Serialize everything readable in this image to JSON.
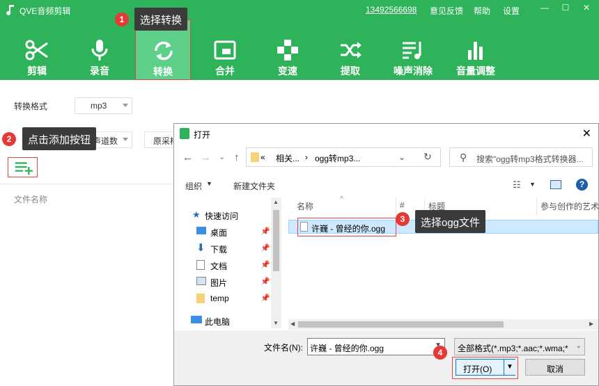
{
  "app": {
    "title": "QVE音频剪辑",
    "phone": "13492566698",
    "feedback": "意见反馈",
    "help": "帮助",
    "settings": "设置",
    "min_glyph": "—",
    "max_glyph": "☐",
    "close_glyph": "✕"
  },
  "toolbar": {
    "items": [
      {
        "label": "剪辑",
        "icon": "scissors-icon"
      },
      {
        "label": "录音",
        "icon": "microphone-icon"
      },
      {
        "label": "转换",
        "icon": "convert-icon"
      },
      {
        "label": "合并",
        "icon": "merge-icon"
      },
      {
        "label": "变速",
        "icon": "speed-icon"
      },
      {
        "label": "提取",
        "icon": "extract-icon"
      },
      {
        "label": "噪声消除",
        "icon": "noise-reduction-icon"
      },
      {
        "label": "音量调整",
        "icon": "volume-icon"
      }
    ],
    "active_index": 2
  },
  "convert": {
    "format_label": "转换格式",
    "format_value": "mp3",
    "channel_value": "声道数",
    "sample_value": "原采样",
    "file_col_header": "文件名称"
  },
  "tips": [
    {
      "num": "1",
      "text": "选择转换"
    },
    {
      "num": "2",
      "text": "点击添加按钮"
    },
    {
      "num": "3",
      "text": "选择ogg文件"
    },
    {
      "num": "4",
      "text": ""
    }
  ],
  "dialog": {
    "title": "打开",
    "breadcrumb_prefix": "«",
    "breadcrumb_1": "相关...",
    "breadcrumb_sep": "›",
    "breadcrumb_2": "ogg转mp3...",
    "search_placeholder": "搜索\"ogg转mp3格式转换器...",
    "organize": "组织",
    "new_folder": "新建文件夹",
    "nav": [
      {
        "label": "快速访问",
        "icon": "star-icon",
        "pinned": false
      },
      {
        "label": "桌面",
        "icon": "desktop-icon",
        "pinned": true
      },
      {
        "label": "下载",
        "icon": "download-icon",
        "pinned": true
      },
      {
        "label": "文档",
        "icon": "document-icon",
        "pinned": true
      },
      {
        "label": "图片",
        "icon": "picture-icon",
        "pinned": true
      },
      {
        "label": "temp",
        "icon": "folder-icon",
        "pinned": true
      },
      {
        "label": "此电脑",
        "icon": "computer-icon",
        "pinned": false
      }
    ],
    "columns": [
      "名称",
      "#",
      "标题",
      "参与创作的艺术"
    ],
    "file_name": "许巍 - 曾经的你.ogg",
    "filename_label": "文件名(N):",
    "filename_value": "许巍 - 曾经的你.ogg",
    "filter_value": "全部格式(*.mp3;*.aac;*.wma;*",
    "open_button": "打开(O)",
    "cancel_button": "取消"
  },
  "colors": {
    "brand": "#2eb35a",
    "tip_bg": "#3b3b3b",
    "badge": "#e53935",
    "highlight": "#e04848"
  }
}
